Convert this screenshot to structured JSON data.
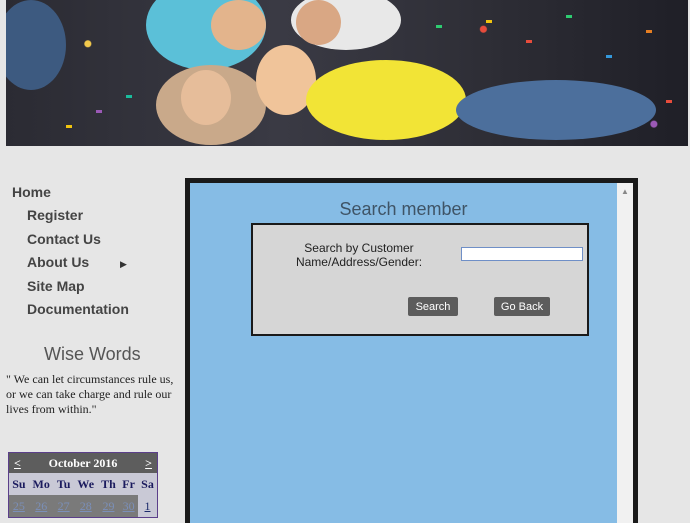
{
  "colors": {
    "panel_bg": "#86bce5",
    "button_bg": "#5c5c5c",
    "calendar_head": "#5d5d5d"
  },
  "menu": {
    "items": [
      {
        "label": "Home"
      },
      {
        "label": "Register"
      },
      {
        "label": "Contact Us"
      },
      {
        "label": "About Us"
      },
      {
        "label": "Site Map"
      },
      {
        "label": "Documentation"
      }
    ],
    "submenu_icon": "right-triangle-icon"
  },
  "wise_words": {
    "title": "Wise Words",
    "quote": "\" We can let circumstances rule us, or we can take charge and rule our lives from within.\""
  },
  "calendar": {
    "prev": "<",
    "next": ">",
    "month_label": "October 2016",
    "weekdays": [
      "Su",
      "Mo",
      "Tu",
      "We",
      "Th",
      "Fr",
      "Sa"
    ],
    "first_week": [
      "25",
      "26",
      "27",
      "28",
      "29",
      "30",
      "1"
    ]
  },
  "search_panel": {
    "title": "Search member",
    "label": "Search by Customer Name/Address/Gender:",
    "input_value": "",
    "search_button": "Search",
    "back_button": "Go Back"
  }
}
